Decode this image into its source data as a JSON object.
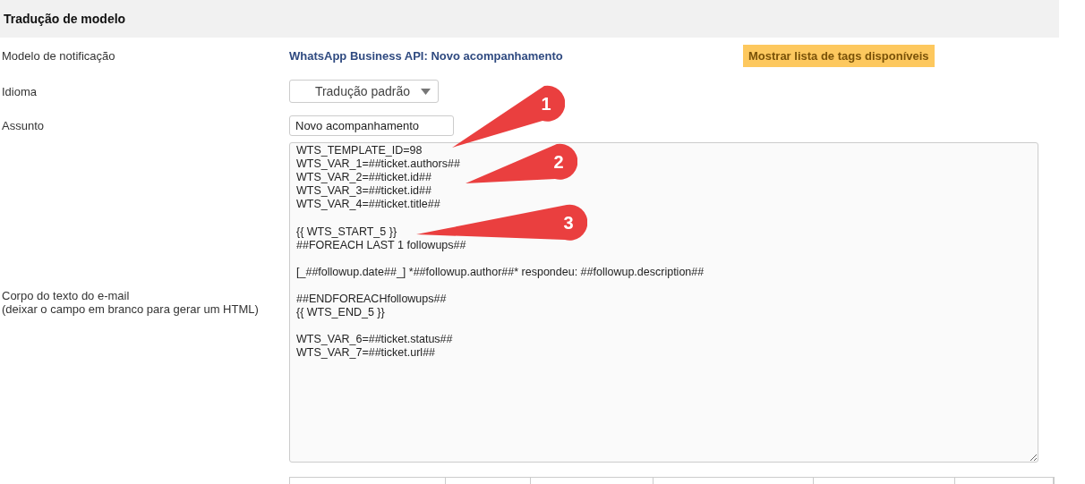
{
  "section_title": "Tradução de modelo",
  "fields": [
    {
      "kind": "link",
      "label": "Modelo de notificação",
      "value": "WhatsApp Business API: Novo acompanhamento",
      "button": "Mostrar lista de tags disponíveis"
    },
    {
      "kind": "select",
      "label": "Idioma",
      "value": "Tradução padrão"
    },
    {
      "kind": "input",
      "label": "Assunto",
      "value": "Novo acompanhamento"
    },
    {
      "kind": "textarea",
      "label": "Corpo do texto do e-mail",
      "hint": "(deixar o campo em branco para gerar um HTML)",
      "value": "WTS_TEMPLATE_ID=98\nWTS_VAR_1=##ticket.authors##\nWTS_VAR_2=##ticket.id##\nWTS_VAR_3=##ticket.id##\nWTS_VAR_4=##ticket.title##\n\n{{ WTS_START_5 }}\n##FOREACH LAST 1 followups##\n\n[_##followup.date##_] *##followup.author##* respondeu: ##followup.description##\n\n##ENDFOREACHfollowups##\n{{ WTS_END_5 }}\n\nWTS_VAR_6=##ticket.status##\nWTS_VAR_7=##ticket.url##"
    }
  ],
  "callouts": [
    "1",
    "2",
    "3"
  ]
}
